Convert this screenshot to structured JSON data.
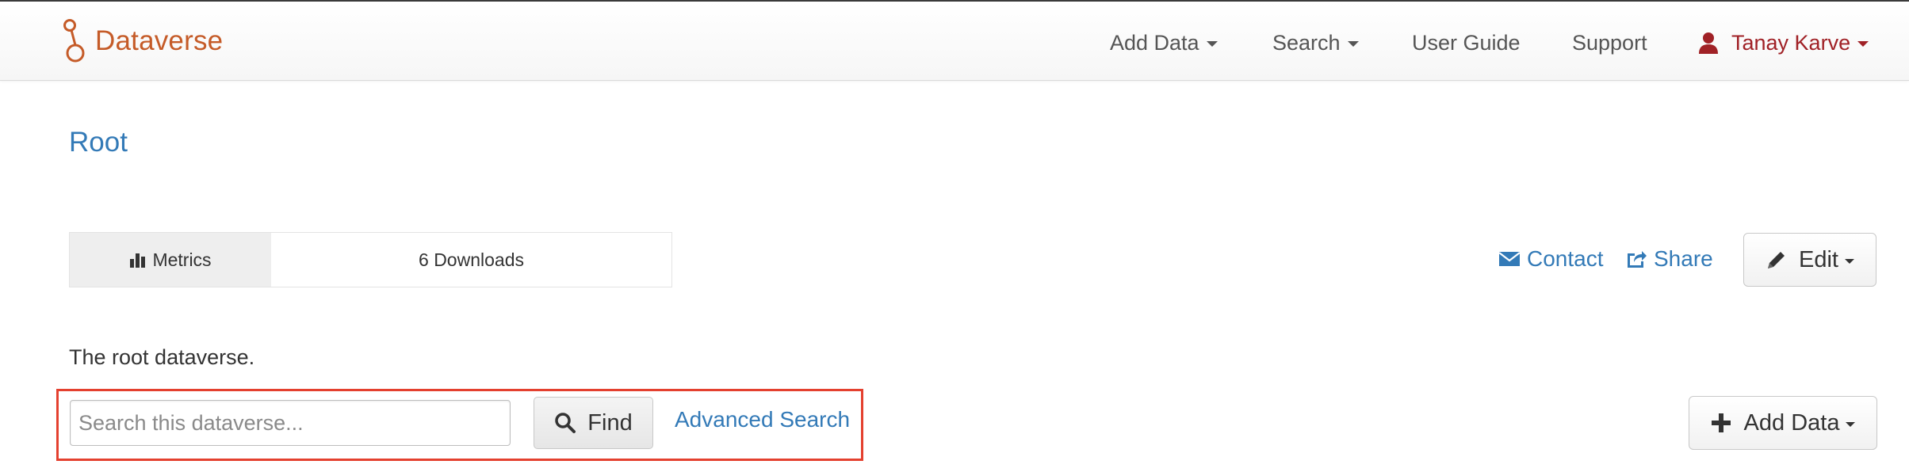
{
  "navbar": {
    "brand": "Dataverse",
    "add_data": "Add Data",
    "search": "Search",
    "user_guide": "User Guide",
    "support": "Support",
    "user": "Tanay Karve"
  },
  "page": {
    "root_link": "Root",
    "description": "The root dataverse."
  },
  "metrics": {
    "label": "Metrics",
    "downloads": "6 Downloads"
  },
  "actions": {
    "contact": "Contact",
    "share": "Share",
    "edit": "Edit"
  },
  "search": {
    "placeholder": "Search this dataverse...",
    "value": "",
    "find": "Find",
    "advanced": "Advanced Search"
  },
  "add_data_button": "Add Data",
  "colors": {
    "brand": "#c55b28",
    "link": "#337ab7",
    "user": "#a02126",
    "highlight": "#e4402f"
  }
}
